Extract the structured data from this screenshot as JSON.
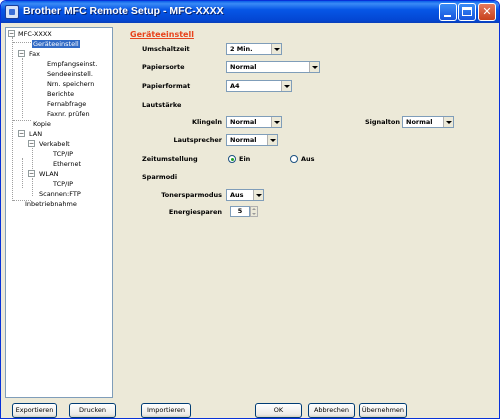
{
  "window": {
    "title": "Brother MFC Remote Setup - MFC-XXXX"
  },
  "tree": {
    "items": [
      {
        "label": "MFC-XXXX"
      },
      {
        "label": "Geräteeinstell"
      },
      {
        "label": "Fax"
      },
      {
        "label": "Empfangseinst."
      },
      {
        "label": "Sendeeinstell."
      },
      {
        "label": "Nrn. speichern"
      },
      {
        "label": "Berichte"
      },
      {
        "label": "Fernabfrage"
      },
      {
        "label": "Faxnr. prüfen"
      },
      {
        "label": "Kopie"
      },
      {
        "label": "LAN"
      },
      {
        "label": "Verkabelt"
      },
      {
        "label": "TCP/IP"
      },
      {
        "label": "Ethernet"
      },
      {
        "label": "WLAN"
      },
      {
        "label": "TCP/IP"
      },
      {
        "label": "Scannen:FTP"
      },
      {
        "label": "Inbetriebnahme"
      }
    ]
  },
  "settings": {
    "section_title": "Geräteeinstell",
    "umschaltzeit": {
      "label": "Umschaltzeit",
      "value": "2 Min."
    },
    "papiersorte": {
      "label": "Papiersorte",
      "value": "Normal"
    },
    "papierformat": {
      "label": "Papierformat",
      "value": "A4"
    },
    "lautstaerke": {
      "label": "Lautstärke"
    },
    "klingeln": {
      "label": "Klingeln",
      "value": "Normal"
    },
    "signalton": {
      "label": "Signalton",
      "value": "Normal"
    },
    "lautsprecher": {
      "label": "Lautsprecher",
      "value": "Normal"
    },
    "zeitumstellung": {
      "label": "Zeitumstellung",
      "option_on": "Ein",
      "option_off": "Aus",
      "selected": "Ein"
    },
    "sparmodi": {
      "label": "Sparmodi"
    },
    "tonersparmodus": {
      "label": "Tonersparmodus",
      "value": "Aus"
    },
    "energiesparen": {
      "label": "Energiesparen",
      "value": "5"
    }
  },
  "buttons": {
    "exportieren": "Exportieren",
    "drucken": "Drucken",
    "importieren": "Importieren",
    "ok": "OK",
    "abbrechen": "Abbrechen",
    "uebernehmen": "Übernehmen"
  },
  "colors": {
    "section_title": "#e8431c",
    "titlebar": "#0656e6",
    "selection": "#316ac5"
  }
}
